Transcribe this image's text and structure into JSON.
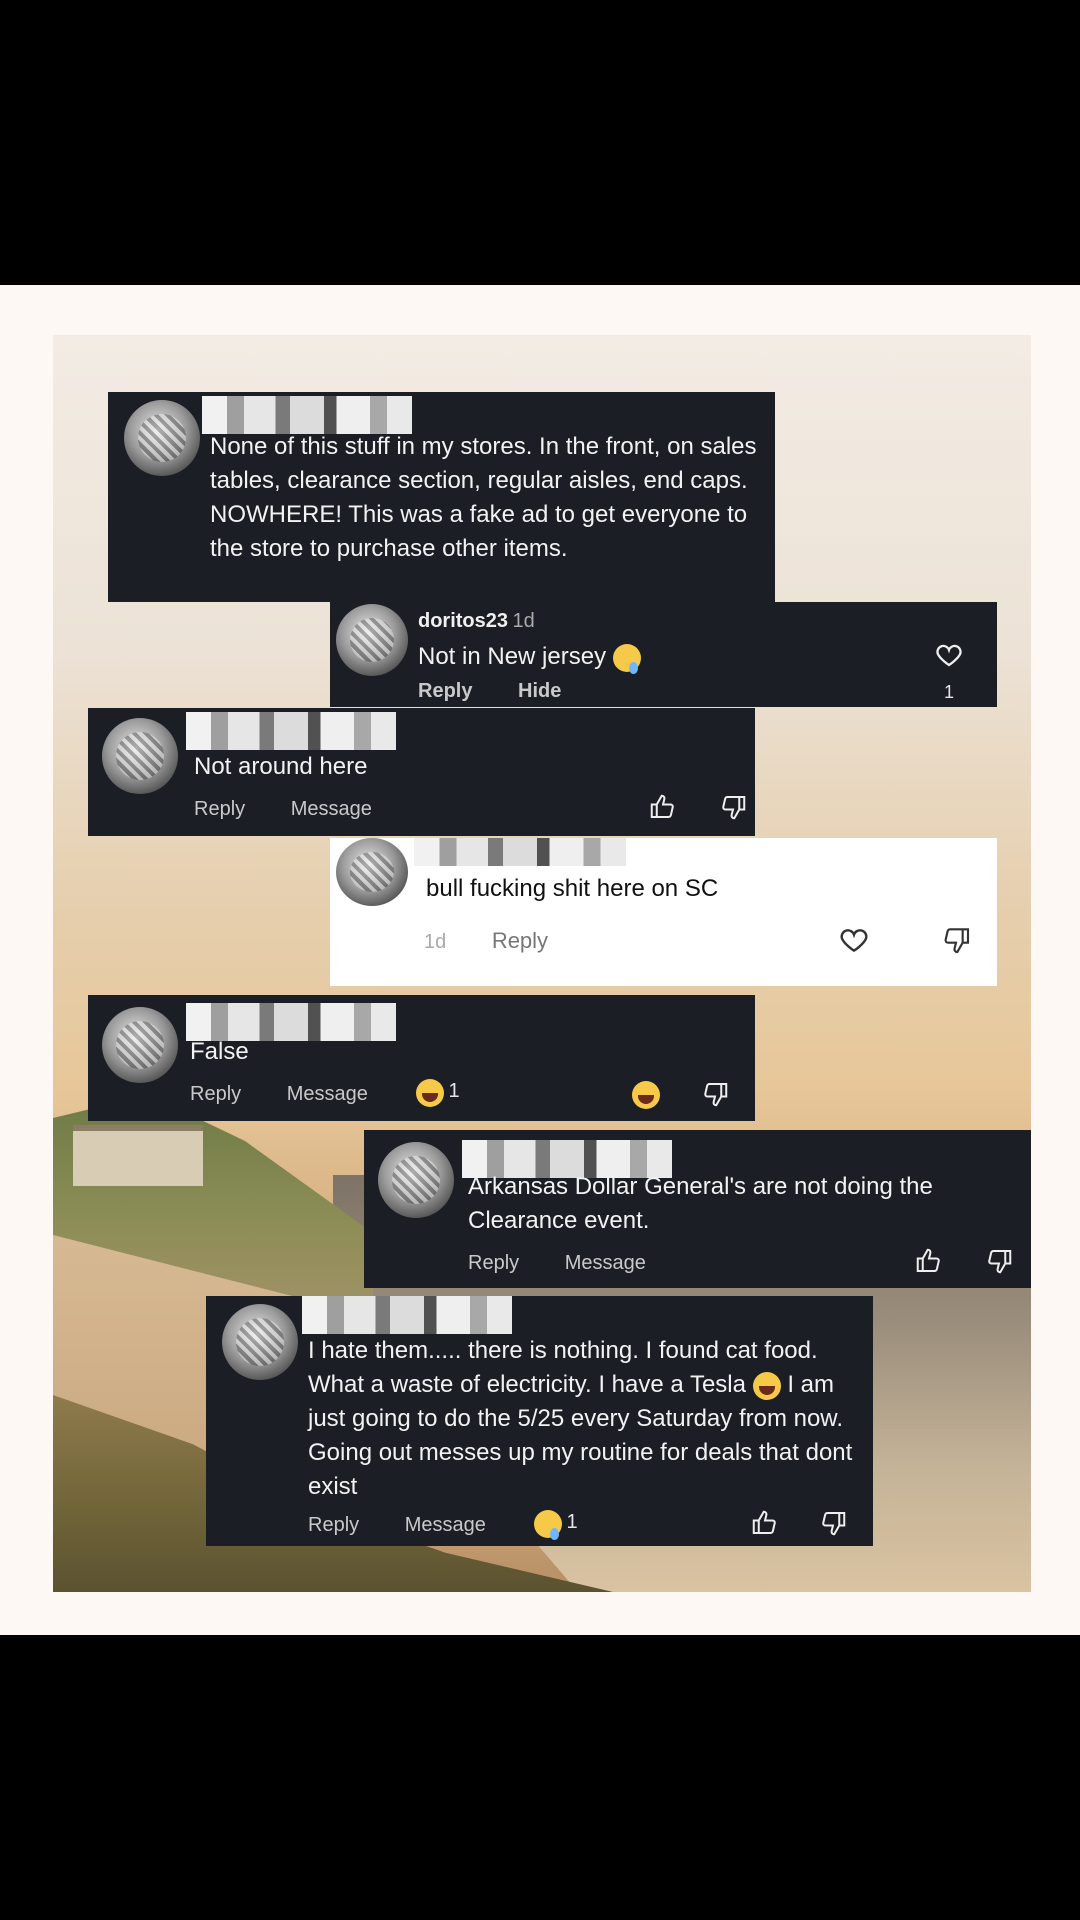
{
  "comments": [
    {
      "text": "None of this stuff in my stores. In the front, on sales tables, clearance section, regular aisles, end caps. NOWHERE! This was a fake ad to get everyone to the store to purchase other items."
    },
    {
      "user": "doritos23",
      "time": "1d",
      "text": "Not in New jersey",
      "reply": "Reply",
      "hide": "Hide",
      "likes": "1"
    },
    {
      "text": "Not around here",
      "reply": "Reply",
      "message": "Message"
    },
    {
      "text": "bull fucking shit here on SC",
      "time": "1d",
      "reply": "Reply"
    },
    {
      "text": "False",
      "reply": "Reply",
      "message": "Message",
      "reaction_count": "1"
    },
    {
      "text": "Arkansas Dollar General's are not doing the Clearance event.",
      "reply": "Reply",
      "message": "Message"
    },
    {
      "text_a": "I hate them..... there is nothing. I found cat food. What a waste of electricity. I have a Tesla",
      "text_b": "I am just going to do the 5/25 every Saturday from now. Going out messes up my routine for deals that dont exist",
      "reply": "Reply",
      "message": "Message",
      "reaction_count": "1"
    }
  ]
}
